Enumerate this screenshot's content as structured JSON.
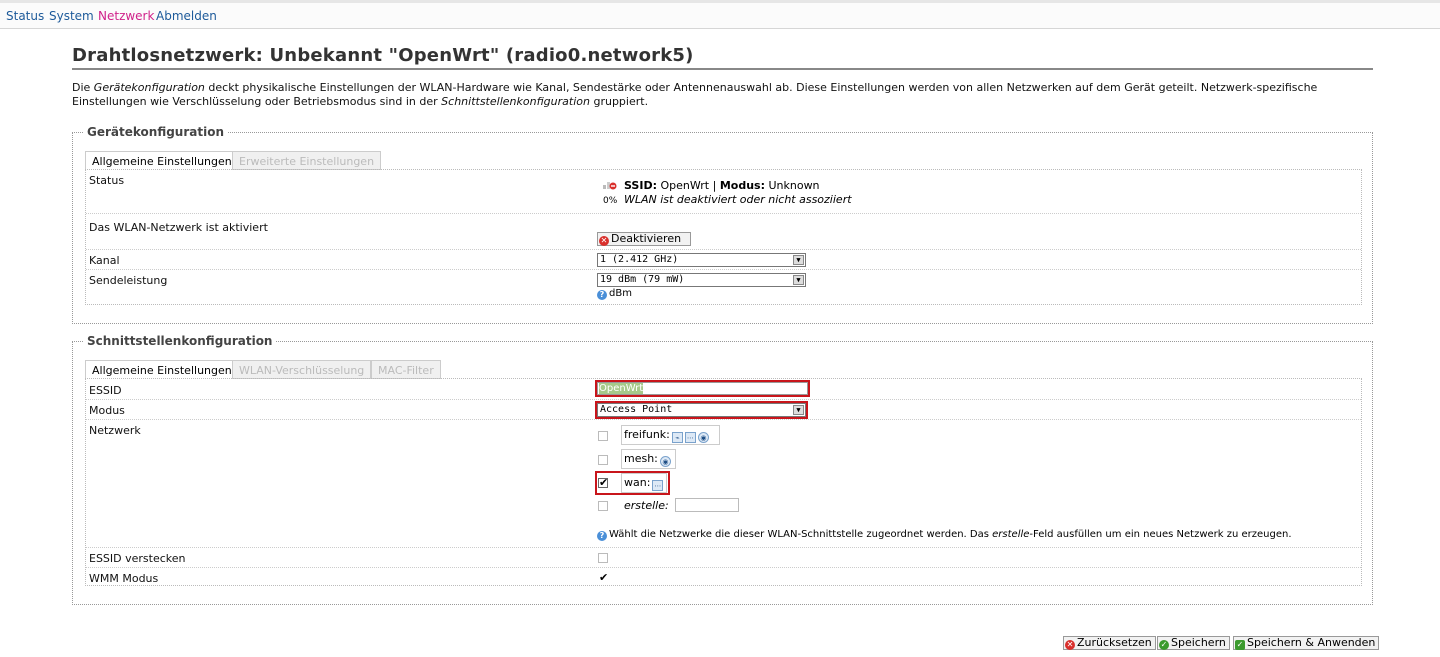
{
  "nav": {
    "items": [
      "Status",
      "System",
      "Netzwerk",
      "Abmelden"
    ],
    "active": "Netzwerk"
  },
  "page": {
    "title": "Drahtlosnetzwerk: Unbekannt \"OpenWrt\" (radio0.network5)",
    "desc_1": "Die ",
    "desc_em1": "Gerätekonfiguration",
    "desc_2": " deckt physikalische Einstellungen der WLAN-Hardware wie Kanal, Sendestärke oder Antennenauswahl ab. Diese Einstellungen werden von allen Netzwerken auf dem Gerät geteilt. Netzwerk-spezifische Einstellungen wie Verschlüsselung oder Betriebsmodus sind in der ",
    "desc_em2": "Schnittstellenkonfiguration",
    "desc_3": " gruppiert."
  },
  "device": {
    "legend": "Gerätekonfiguration",
    "tabs": [
      "Allgemeine Einstellungen",
      "Erweiterte Einstellungen"
    ],
    "status_label": "Status",
    "signal_pct": "0%",
    "ssid_key": "SSID:",
    "ssid_value": "OpenWrt",
    "sep": "|",
    "mode_key": "Modus:",
    "mode_value": "Unknown",
    "status_note": "WLAN ist deaktiviert oder nicht assoziiert",
    "enabled_label": "Das WLAN-Netzwerk ist aktiviert",
    "deactivate_btn": "Deaktivieren",
    "channel_label": "Kanal",
    "channel_value": "1 (2.412 GHz)",
    "txpower_label": "Sendeleistung",
    "txpower_value": "19 dBm (79 mW)",
    "txpower_help": "dBm"
  },
  "iface": {
    "legend": "Schnittstellenkonfiguration",
    "tabs": [
      "Allgemeine Einstellungen",
      "WLAN-Verschlüsselung",
      "MAC-Filter"
    ],
    "essid_label": "ESSID",
    "essid_value": "OpenWrt",
    "mode_label": "Modus",
    "mode_value": "Access Point",
    "network_label": "Netzwerk",
    "networks": [
      {
        "name": "freifunk:",
        "checked": false
      },
      {
        "name": "mesh:",
        "checked": false
      },
      {
        "name": "wan:",
        "checked": true
      }
    ],
    "create_label": "erstelle:",
    "create_value": "",
    "help_1": "Wählt die Netzwerke die dieser WLAN-Schnittstelle zugeordnet werden. Das ",
    "help_em": "erstelle",
    "help_2": "-Feld ausfüllen um ein neues Netzwerk zu erzeugen.",
    "hide_essid_label": "ESSID verstecken",
    "hide_essid_checked": false,
    "wmm_label": "WMM Modus",
    "wmm_checked": true
  },
  "footer": {
    "reset": "Zurücksetzen",
    "save": "Speichern",
    "save_apply": "Speichern & Anwenden"
  },
  "colors": {
    "link": "#1d5a9a",
    "active_link": "#d0228a",
    "highlight": "#c8151b"
  }
}
